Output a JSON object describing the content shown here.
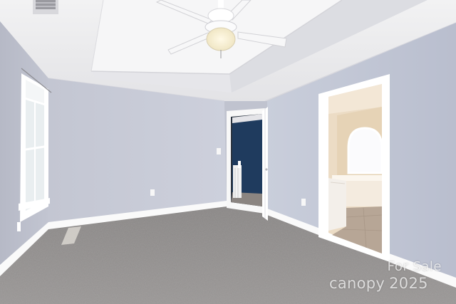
{
  "photo": {
    "subject": "empty-bedroom",
    "colors": {
      "wall": "#c4c8d6",
      "ceiling": "#eeeeee",
      "trim": "#ffffff",
      "carpet": "#8d8a88",
      "accent_wall": "#1e3a5a",
      "bath_floor": "#b7a696"
    }
  },
  "watermark": {
    "line1": "For Sale",
    "brand": "canopy",
    "year": "2025"
  }
}
